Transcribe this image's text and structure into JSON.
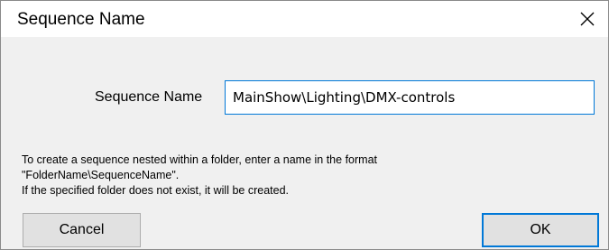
{
  "window": {
    "title": "Sequence Name",
    "close_icon": "close-icon"
  },
  "form": {
    "label": "Sequence Name",
    "value": "MainShow\\Lighting\\DMX-controls"
  },
  "help": {
    "lines": [
      "To create a sequence nested within a folder, enter a name in the format",
      "\"FolderName\\SequenceName\".",
      "If the specified folder does not exist, it will be created."
    ]
  },
  "buttons": {
    "cancel": "Cancel",
    "ok": "OK"
  },
  "colors": {
    "accent": "#0078d7",
    "titlebar": "#ffffff",
    "background": "#f0f0f0"
  }
}
